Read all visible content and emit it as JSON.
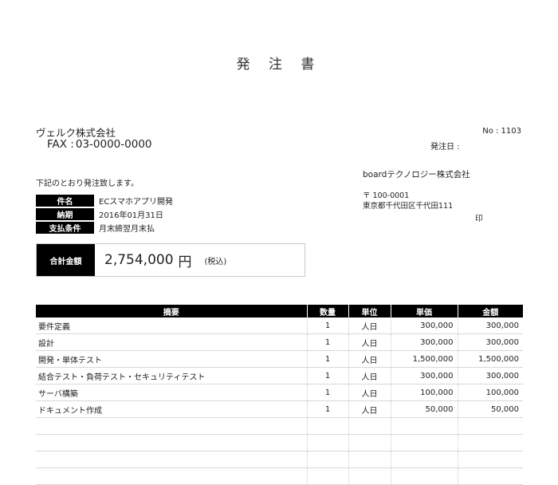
{
  "document": {
    "title": "発 注 書",
    "number": "No : 1103",
    "issue_date_label": "発注日 :"
  },
  "recipient": {
    "name": "ヴェルク株式会社",
    "fax_label": "FAX :",
    "fax": "03-0000-0000"
  },
  "intro": "下記のとおり発注致します。",
  "info": [
    {
      "label": "件名",
      "value": "ECスマホアプリ開発"
    },
    {
      "label": "納期",
      "value": "2016年01月31日"
    },
    {
      "label": "支払条件",
      "value": "月末締翌月末払"
    }
  ],
  "total": {
    "label": "合計金額",
    "amount": "2,754,000",
    "currency": "円",
    "tax_note": "(税込)"
  },
  "issuer": {
    "name": "boardテクノロジー株式会社",
    "postal": "〒 100-0001",
    "address": "東京都千代田区千代田111",
    "seal": "印"
  },
  "items": {
    "headers": [
      "摘要",
      "数量",
      "単位",
      "単価",
      "金額"
    ],
    "rows": [
      {
        "desc": "要件定義",
        "qty": "1",
        "unit": "人日",
        "price": "300,000",
        "amount": "300,000"
      },
      {
        "desc": "設計",
        "qty": "1",
        "unit": "人日",
        "price": "300,000",
        "amount": "300,000"
      },
      {
        "desc": "開発・単体テスト",
        "qty": "1",
        "unit": "人日",
        "price": "1,500,000",
        "amount": "1,500,000"
      },
      {
        "desc": "結合テスト・負荷テスト・セキュリティテスト",
        "qty": "1",
        "unit": "人日",
        "price": "300,000",
        "amount": "300,000"
      },
      {
        "desc": "サーバ構築",
        "qty": "1",
        "unit": "人日",
        "price": "100,000",
        "amount": "100,000"
      },
      {
        "desc": "ドキュメント作成",
        "qty": "1",
        "unit": "人日",
        "price": "50,000",
        "amount": "50,000"
      },
      {
        "desc": "",
        "qty": "",
        "unit": "",
        "price": "",
        "amount": ""
      },
      {
        "desc": "",
        "qty": "",
        "unit": "",
        "price": "",
        "amount": ""
      },
      {
        "desc": "",
        "qty": "",
        "unit": "",
        "price": "",
        "amount": ""
      },
      {
        "desc": "",
        "qty": "",
        "unit": "",
        "price": "",
        "amount": ""
      }
    ]
  }
}
